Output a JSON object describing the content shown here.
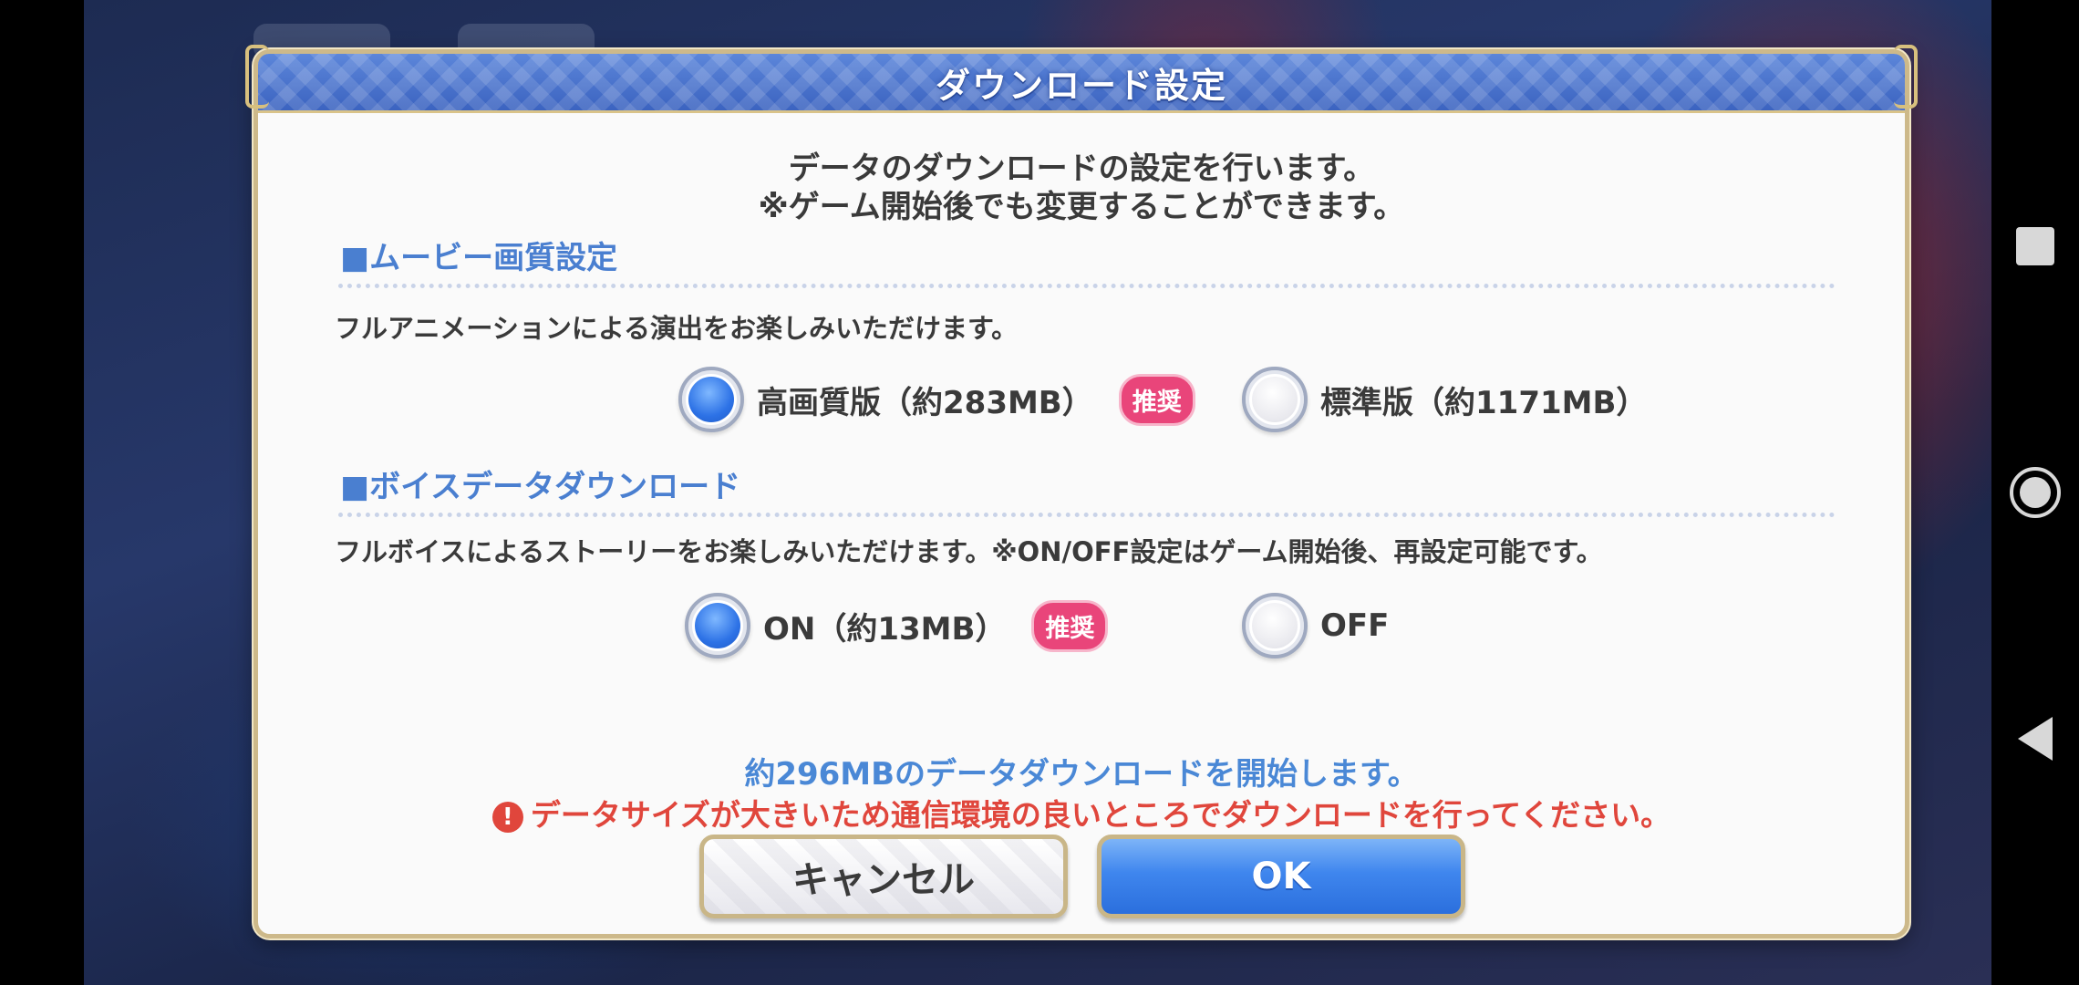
{
  "dialog": {
    "title": "ダウンロード設定",
    "intro_line1": "データのダウンロードの設定を行います。",
    "intro_line2": "※ゲーム開始後でも変更することができます。"
  },
  "movie": {
    "heading": "■ムービー画質設定",
    "description": "フルアニメーションによる演出をお楽しみいただけます。",
    "options": [
      {
        "label": "高画質版（約283MB）",
        "selected": true,
        "badge": "推奨"
      },
      {
        "label": "標準版（約1171MB）",
        "selected": false
      }
    ]
  },
  "voice": {
    "heading": "■ボイスデータダウンロード",
    "description": "フルボイスによるストーリーをお楽しみいただけます。※ON/OFF設定はゲーム開始後、再設定可能です。",
    "options": [
      {
        "label": "ON（約13MB）",
        "selected": true,
        "badge": "推奨"
      },
      {
        "label": "OFF",
        "selected": false
      }
    ]
  },
  "summary": "約296MBのデータダウンロードを開始します。",
  "warning": "データサイズが大きいため通信環境の良いところでダウンロードを行ってください。",
  "buttons": {
    "cancel": "キャンセル",
    "ok": "OK"
  },
  "colors": {
    "accent_blue": "#4a7fd0",
    "badge_pink": "#e9457a",
    "warning_red": "#e0463c"
  }
}
